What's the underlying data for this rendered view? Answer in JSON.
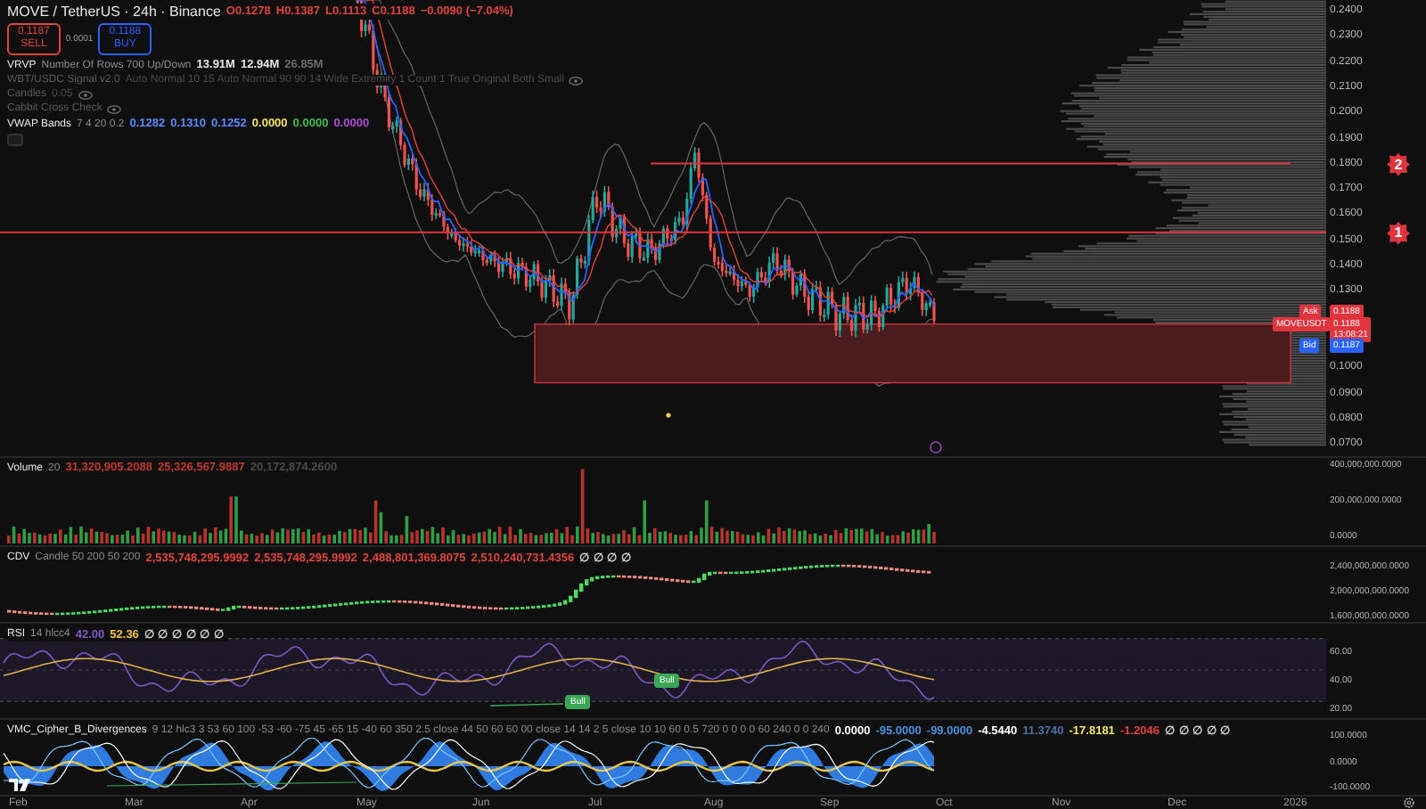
{
  "header": {
    "symbol": "MOVE / TetherUS · 24h · Binance",
    "ohlc": [
      {
        "label": "O",
        "value": "0.1278"
      },
      {
        "label": "H",
        "value": "0.1387"
      },
      {
        "label": "L",
        "value": "0.1113"
      },
      {
        "label": "C",
        "value": "0.1188"
      }
    ],
    "change": "−0.0090 (−7.04%)"
  },
  "trade": {
    "sell": {
      "price": "0.1187",
      "label": "SELL"
    },
    "spread": "0.0001",
    "buy": {
      "price": "0.1188",
      "label": "BUY"
    }
  },
  "indicators": [
    {
      "name": "VRVP",
      "params": "Number Of Rows 700 Up/Down",
      "hidden": false,
      "values": [
        {
          "text": "13.91M",
          "color": "#e6e6e6"
        },
        {
          "text": "12.94M",
          "color": "#e6e6e6"
        },
        {
          "text": "26.85M",
          "color": "#6a6a6a"
        }
      ]
    },
    {
      "name": "WBT/USDC Signal v2.0",
      "params": "Auto Normal 10 15 Auto Normal 90 90 14 Wide Extremity 1 Count 1 True Original Both Small",
      "hidden": true
    },
    {
      "name": "Candles",
      "params": "0.05",
      "hidden": true
    },
    {
      "name": "Cabbit Cross Check",
      "hidden": true
    },
    {
      "name": "VWAP Bands",
      "params": "7 4 20 0.2",
      "hidden": false,
      "values": [
        {
          "text": "0.1282",
          "color": "#5b8cff"
        },
        {
          "text": "0.1310",
          "color": "#5b8cff"
        },
        {
          "text": "0.1252",
          "color": "#5b8cff"
        },
        {
          "text": "0.0000",
          "color": "#f5e663"
        },
        {
          "text": "0.0000",
          "color": "#3fbf4f"
        },
        {
          "text": "0.0000",
          "color": "#b04fd6"
        }
      ]
    }
  ],
  "price_ticks": [
    "0.2400",
    "0.2300",
    "0.2200",
    "0.2100",
    "0.2000",
    "0.1900",
    "0.1800",
    "0.1700",
    "0.1600",
    "0.1500",
    "0.1400",
    "0.1300",
    "0.1000",
    "0.0900",
    "0.0800",
    "0.0700"
  ],
  "markers": [
    {
      "label": "2"
    },
    {
      "label": "1"
    }
  ],
  "price_labels": [
    {
      "kind": "ask",
      "label": "Ask",
      "value": "0.1188"
    },
    {
      "kind": "last",
      "label": "MOVEUSDT",
      "value": "0.1188",
      "time": "13:08:21"
    },
    {
      "kind": "bid",
      "label": "Bid",
      "value": "0.1187"
    }
  ],
  "volume": {
    "title": "Volume",
    "params": "20",
    "values": [
      {
        "text": "31,320,905.2088",
        "color": "#c0392b"
      },
      {
        "text": "25,326,567.9887",
        "color": "#c0392b"
      },
      {
        "text": "20,172,874.2600",
        "color": "#4a4a4a"
      }
    ],
    "ticks": [
      "400,000,000.0000",
      "200,000,000.0000",
      "0.0000"
    ]
  },
  "cdv": {
    "title": "CDV",
    "params": "Candle 50 200 50 200",
    "values": [
      {
        "text": "2,535,748,295.9992",
        "color": "#e0443a"
      },
      {
        "text": "2,535,748,295.9992",
        "color": "#e0443a"
      },
      {
        "text": "2,488,801,369.8075",
        "color": "#e0443a"
      },
      {
        "text": "2,510,240,731.4356",
        "color": "#e0443a"
      },
      {
        "text": "∅ ∅ ∅ ∅",
        "color": "#d0d0d0"
      }
    ],
    "ticks": [
      "2,400,000,000.0000",
      "2,000,000,000.0000",
      "1,600,000,000.0000"
    ]
  },
  "rsi": {
    "title": "RSI",
    "params": "14 hlcc4",
    "values": [
      {
        "text": "42.00",
        "color": "#7e57c2"
      },
      {
        "text": "52.36",
        "color": "#f5c542"
      },
      {
        "text": "∅ ∅ ∅ ∅ ∅ ∅",
        "color": "#d0d0d0"
      }
    ],
    "ticks": [
      "60.00",
      "40.00",
      "20.00"
    ],
    "signals": [
      {
        "label": "Bull"
      },
      {
        "label": "Bull"
      }
    ]
  },
  "cipher": {
    "title": "VMC_Cipher_B_Divergences",
    "params": "9 12 hlc3 3 53 60 100 -53 -60 -75 45 -65 15 -40 60 350 2.5 close 44 50 60 60 00 close 14 14 2 5 close 10 10 60 0.5 720 0 0 0 0 60 240 0 0 240",
    "values": [
      {
        "text": "0.0000",
        "color": "#ffffff"
      },
      {
        "text": "-95.0000",
        "color": "#4a90e2"
      },
      {
        "text": "-99.0000",
        "color": "#4a90e2"
      },
      {
        "text": "-4.5440",
        "color": "#ffffff"
      },
      {
        "text": "11.3740",
        "color": "#4a6fa5"
      },
      {
        "text": "-17.8181",
        "color": "#f5e663"
      },
      {
        "text": "-1.2046",
        "color": "#e0443a"
      },
      {
        "text": "∅ ∅ ∅ ∅ ∅",
        "color": "#d0d0d0"
      }
    ],
    "ticks": [
      "100.0000",
      "0.0000",
      "-100.0000"
    ]
  },
  "time_axis": [
    "Feb",
    "Mar",
    "Apr",
    "May",
    "Jun",
    "Jul",
    "Aug",
    "Sep",
    "Oct",
    "Nov",
    "Dec",
    "2026"
  ]
}
